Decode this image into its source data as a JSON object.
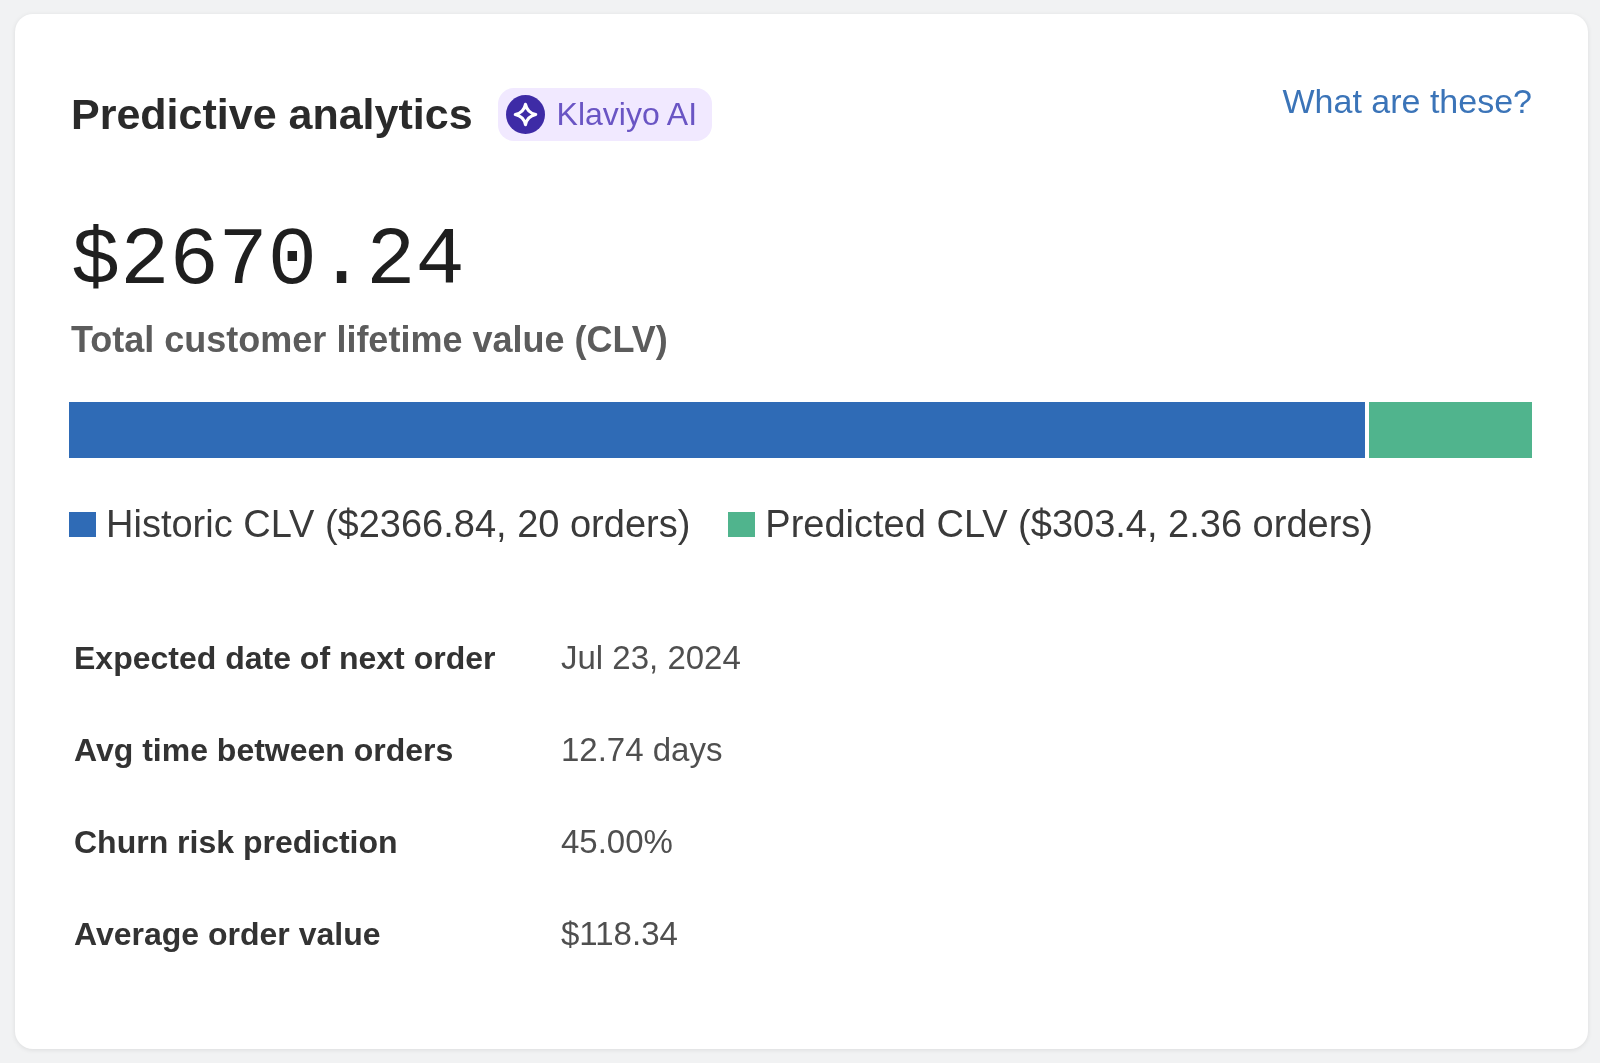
{
  "title": "Predictive analytics",
  "badge": {
    "label": "Klaviyo AI"
  },
  "help_link": {
    "label": "What are these?"
  },
  "total_clv": {
    "value": "$2670.24",
    "label": "Total customer lifetime value (CLV)"
  },
  "clv_bar": {
    "segments": [
      {
        "legend": "Historic CLV ($2366.84, 20 orders)",
        "color": "#2f6bb6",
        "level": 0.886
      },
      {
        "legend": "Predicted CLV ($303.4, 2.36 orders)",
        "color": "#50b48d",
        "level": 0.114
      }
    ]
  },
  "stats": [
    {
      "label": "Expected date of next order",
      "value": "Jul 23, 2024"
    },
    {
      "label": "Avg time between orders",
      "value": "12.74 days"
    },
    {
      "label": "Churn risk prediction",
      "value": "45.00%"
    },
    {
      "label": "Average order value",
      "value": "$118.34"
    }
  ]
}
